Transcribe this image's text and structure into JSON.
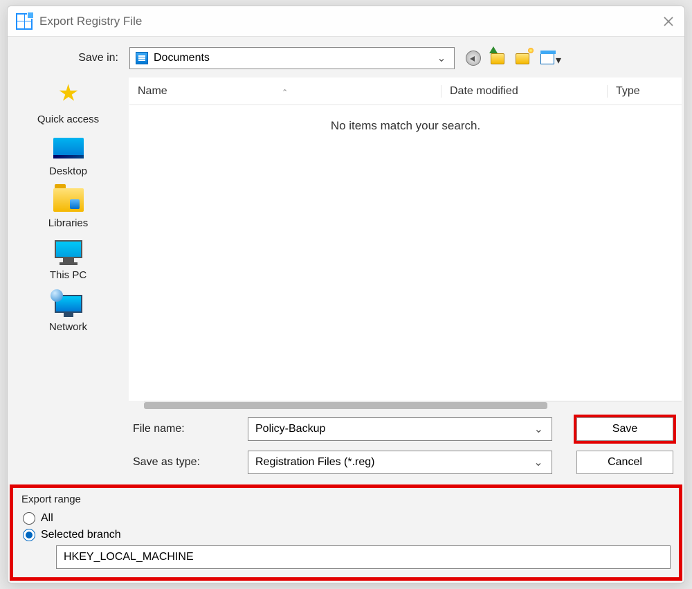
{
  "titlebar": {
    "title": "Export Registry File"
  },
  "savein": {
    "label": "Save in:",
    "value": "Documents"
  },
  "sidebar": {
    "items": [
      {
        "label": "Quick access"
      },
      {
        "label": "Desktop"
      },
      {
        "label": "Libraries"
      },
      {
        "label": "This PC"
      },
      {
        "label": "Network"
      }
    ]
  },
  "columns": {
    "name": "Name",
    "date": "Date modified",
    "type": "Type"
  },
  "empty": "No items match your search.",
  "form": {
    "filename_label": "File name:",
    "filename_value": "Policy-Backup",
    "saveastype_label": "Save as type:",
    "saveastype_value": "Registration Files (*.reg)",
    "save_button": "Save",
    "cancel_button": "Cancel"
  },
  "export_range": {
    "legend": "Export range",
    "all_label": "All",
    "selected_label": "Selected branch",
    "branch_value": "HKEY_LOCAL_MACHINE"
  }
}
